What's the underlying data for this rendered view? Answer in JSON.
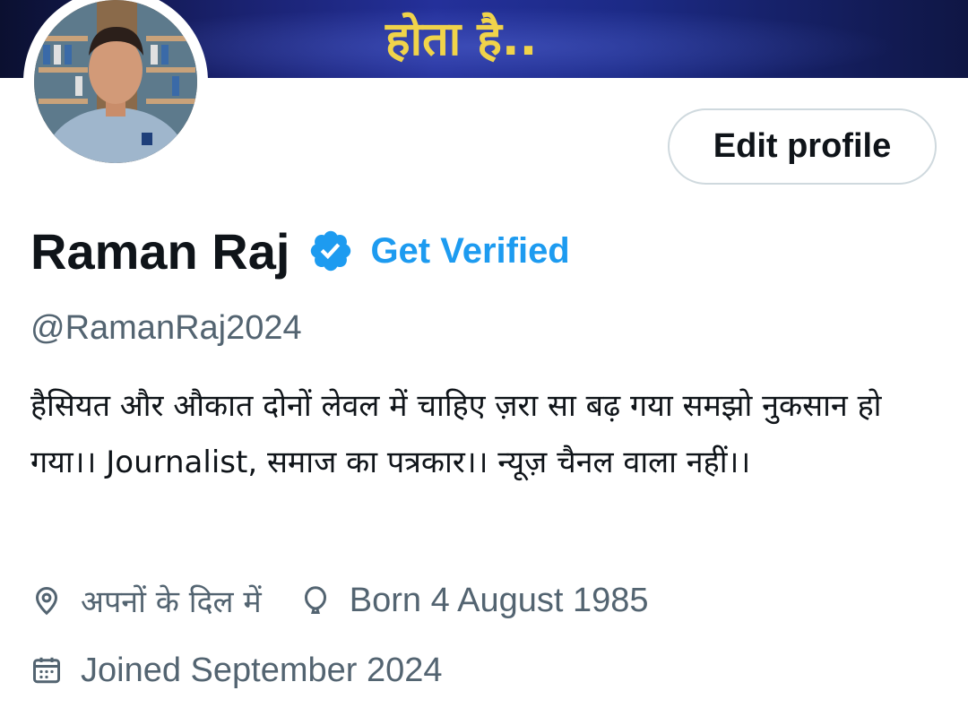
{
  "banner": {
    "text": "होता है.."
  },
  "profile": {
    "edit_label": "Edit profile",
    "display_name": "Raman Raj",
    "get_verified_label": "Get Verified",
    "handle": "@RamanRaj2024",
    "bio": "हैसियत और औकात दोनों लेवल में चाहिए ज़रा सा बढ़ गया समझो नुकसान हो गया।। Journalist, समाज का पत्रकार।। न्यूज़ चैनल वाला नहीं।।",
    "location": "अपनों के दिल में",
    "birthday": "Born 4 August 1985",
    "joined": "Joined September 2024"
  },
  "icons": {
    "verified": "verified-badge-icon",
    "location": "location-pin-icon",
    "birthday": "balloon-icon",
    "joined": "calendar-icon"
  },
  "colors": {
    "accent": "#1d9bf0",
    "muted": "#536471",
    "text": "#0f1419",
    "button_border": "#cfd9de",
    "banner_text": "#f0d34a"
  }
}
